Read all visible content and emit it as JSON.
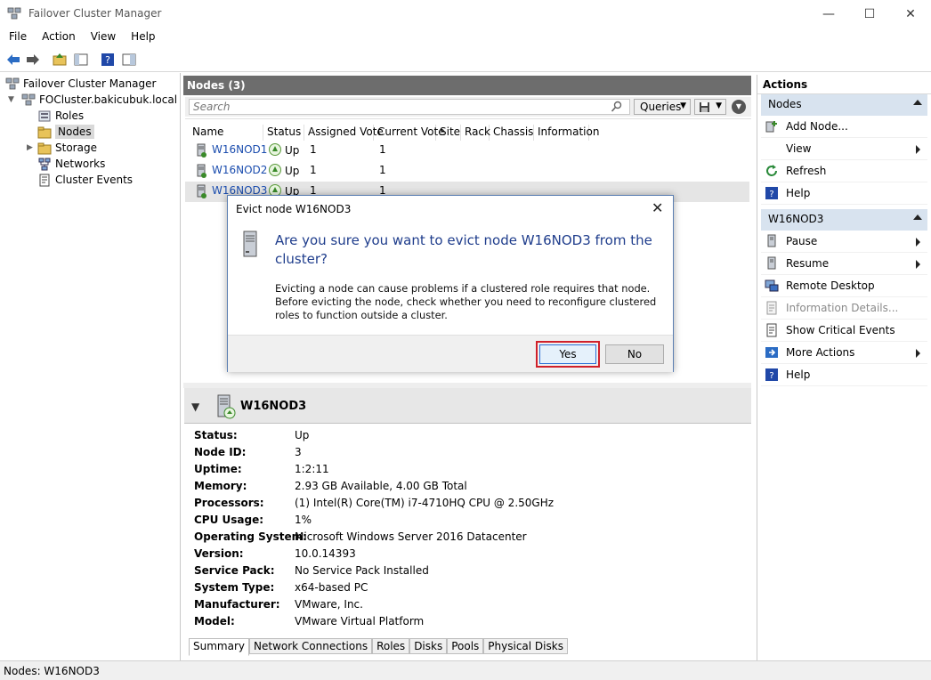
{
  "window": {
    "title": "Failover Cluster Manager",
    "min": "—",
    "max": "☐",
    "close": "✕"
  },
  "menu": [
    "File",
    "Action",
    "View",
    "Help"
  ],
  "tree": {
    "root": "Failover Cluster Manager",
    "cluster": "FOCluster.bakicubuk.local",
    "items": [
      "Roles",
      "Nodes",
      "Storage",
      "Networks",
      "Cluster Events"
    ]
  },
  "nodes_panel": {
    "title": "Nodes (3)",
    "search_placeholder": "Search",
    "queries_label": "Queries",
    "columns": [
      "Name",
      "Status",
      "Assigned Vote",
      "Current Vote",
      "Site",
      "Rack",
      "Chassis",
      "Information"
    ],
    "rows": [
      {
        "name": "W16NOD1",
        "status": "Up",
        "assigned": "1",
        "current": "1"
      },
      {
        "name": "W16NOD2",
        "status": "Up",
        "assigned": "1",
        "current": "1"
      },
      {
        "name": "W16NOD3",
        "status": "Up",
        "assigned": "1",
        "current": "1"
      }
    ]
  },
  "detail": {
    "title": "W16NOD3",
    "props": [
      {
        "k": "Status:",
        "v": "Up"
      },
      {
        "k": "Node ID:",
        "v": "3"
      },
      {
        "k": "Uptime:",
        "v": "1:2:11"
      },
      {
        "k": "Memory:",
        "v": "2.93 GB Available, 4.00 GB Total"
      },
      {
        "k": "Processors:",
        "v": "(1) Intel(R) Core(TM) i7-4710HQ CPU @ 2.50GHz"
      },
      {
        "k": "CPU Usage:",
        "v": "1%"
      },
      {
        "k": "Operating System:",
        "v": "Microsoft Windows Server 2016 Datacenter"
      },
      {
        "k": "Version:",
        "v": "10.0.14393"
      },
      {
        "k": "Service Pack:",
        "v": "No Service Pack Installed"
      },
      {
        "k": "System Type:",
        "v": "x64-based PC"
      },
      {
        "k": "Manufacturer:",
        "v": "VMware, Inc."
      },
      {
        "k": "Model:",
        "v": "VMware Virtual Platform"
      }
    ],
    "tabs": [
      "Summary",
      "Network Connections",
      "Roles",
      "Disks",
      "Pools",
      "Physical Disks"
    ]
  },
  "actions": {
    "title": "Actions",
    "section1": "Nodes",
    "section1_items": [
      "Add Node...",
      "View",
      "Refresh",
      "Help"
    ],
    "section2": "W16NOD3",
    "section2_items": [
      "Pause",
      "Resume",
      "Remote Desktop",
      "Information Details...",
      "Show Critical Events",
      "More Actions",
      "Help"
    ]
  },
  "statusbar": "Nodes:  W16NOD3",
  "dialog": {
    "title": "Evict node W16NOD3",
    "question": "Are you sure you want to evict node W16NOD3 from the cluster?",
    "message": "Evicting a node can cause problems if a clustered role requires that node.  Before evicting the node, check whether you need to reconfigure clustered roles to function outside a cluster.",
    "yes": "Yes",
    "no": "No"
  },
  "colors": {
    "header": "#6d6d6d",
    "section": "#d8e3ef",
    "highlight": "#d0202a",
    "link": "#1b4dae"
  }
}
